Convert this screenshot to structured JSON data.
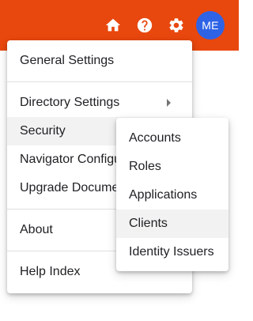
{
  "appbar": {
    "color": "#e8470d",
    "icons": [
      "home-icon",
      "help-icon",
      "gear-icon"
    ],
    "avatar": {
      "initials": "ME",
      "color": "#2f63e6"
    }
  },
  "menu": {
    "general_settings": "General Settings",
    "directory_settings": "Directory Settings",
    "security": "Security",
    "navigator_config": "Navigator Configuration",
    "upgrade_documents": "Upgrade Documents",
    "about": "About",
    "help_index": "Help Index"
  },
  "security_submenu": {
    "items": [
      "Accounts",
      "Roles",
      "Applications",
      "Clients",
      "Identity Issuers"
    ],
    "highlighted": "Clients"
  }
}
